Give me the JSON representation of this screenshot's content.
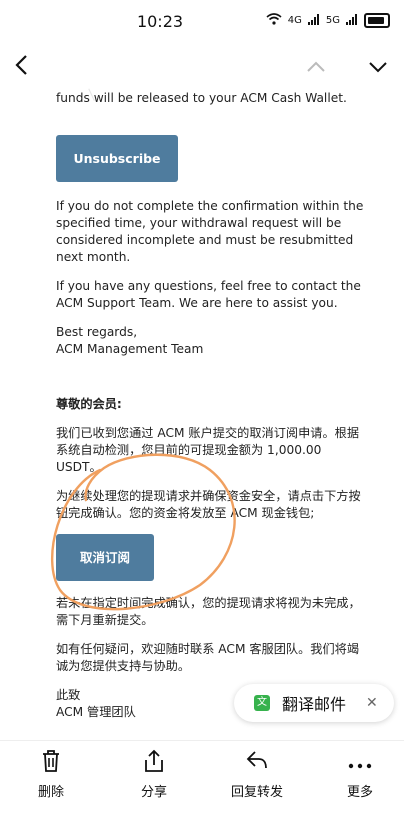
{
  "status": {
    "time": "10:23",
    "signal1": "4G",
    "signal2": "5G"
  },
  "nav": {
    "back": "<",
    "up": "∧",
    "down": "∨"
  },
  "email": {
    "p0": "funds will be released to your ACM Cash Wallet.",
    "unsubscribe_en": "Unsubscribe",
    "p1": "If you do not complete the confirmation within the specified time, your withdrawal request will be considered incomplete and must be resubmitted next month.",
    "p2": "If you have any questions, feel free to contact the ACM Support Team. We are here to assist you.",
    "regards_1": "Best regards,",
    "regards_2": "ACM Management Team",
    "zh_greeting": "尊敬的会员:",
    "zh_p1": "我们已收到您通过 ACM 账户提交的取消订阅申请。根据系统自动检测，您目前的可提现金额为 1,000.00 USDT。",
    "zh_p2": "为继续处理您的提现请求并确保资金安全，请点击下方按钮完成确认。您的资金将发放至 ACM 现金钱包;",
    "unsubscribe_zh": "取消订阅",
    "zh_p3": "若未在指定时间完成确认，您的提现请求将视为未完成，需下月重新提交。",
    "zh_p4": "如有任何疑问，欢迎随时联系 ACM 客服团队。我们将竭诚为您提供支持与协助。",
    "zh_sign_1": "此致",
    "zh_sign_2": "ACM 管理团队"
  },
  "translate": {
    "label": "翻译邮件",
    "icon": "translate-icon"
  },
  "bottom_tabs": [
    {
      "label": "删除",
      "icon": "trash-icon"
    },
    {
      "label": "分享",
      "icon": "share-icon"
    },
    {
      "label": "回复转发",
      "icon": "reply-icon"
    },
    {
      "label": "更多",
      "icon": "more-icon"
    }
  ],
  "colors": {
    "button": "#4f7c9e",
    "annotation": "#f0a060"
  }
}
